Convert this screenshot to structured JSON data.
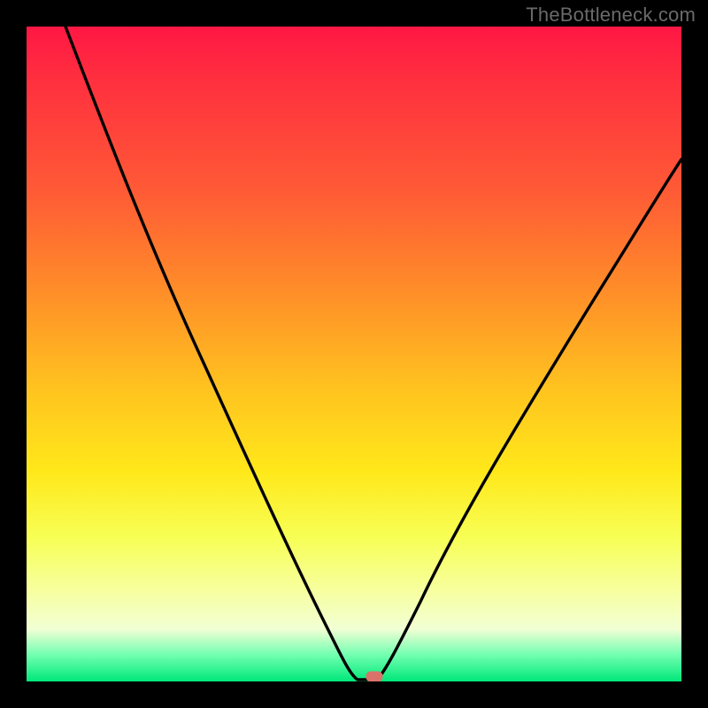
{
  "watermark": "TheBottleneck.com",
  "chart_data": {
    "type": "line",
    "title": "",
    "xlabel": "",
    "ylabel": "",
    "x_range": [
      0,
      100
    ],
    "y_range": [
      0,
      100
    ],
    "series": [
      {
        "name": "curve",
        "x": [
          6,
          10,
          15,
          20,
          25,
          30,
          35,
          40,
          44,
          47,
          49,
          50.5,
          53.5,
          55,
          58,
          62,
          68,
          75,
          82,
          90,
          100
        ],
        "values": [
          100,
          90,
          78,
          66,
          55,
          45,
          35,
          25,
          16,
          9,
          3,
          0,
          0,
          3,
          9,
          16,
          26,
          37,
          48,
          60,
          76
        ]
      }
    ],
    "marker": {
      "x": 53,
      "y": 0.8
    },
    "background": "red-yellow-green vertical gradient"
  }
}
